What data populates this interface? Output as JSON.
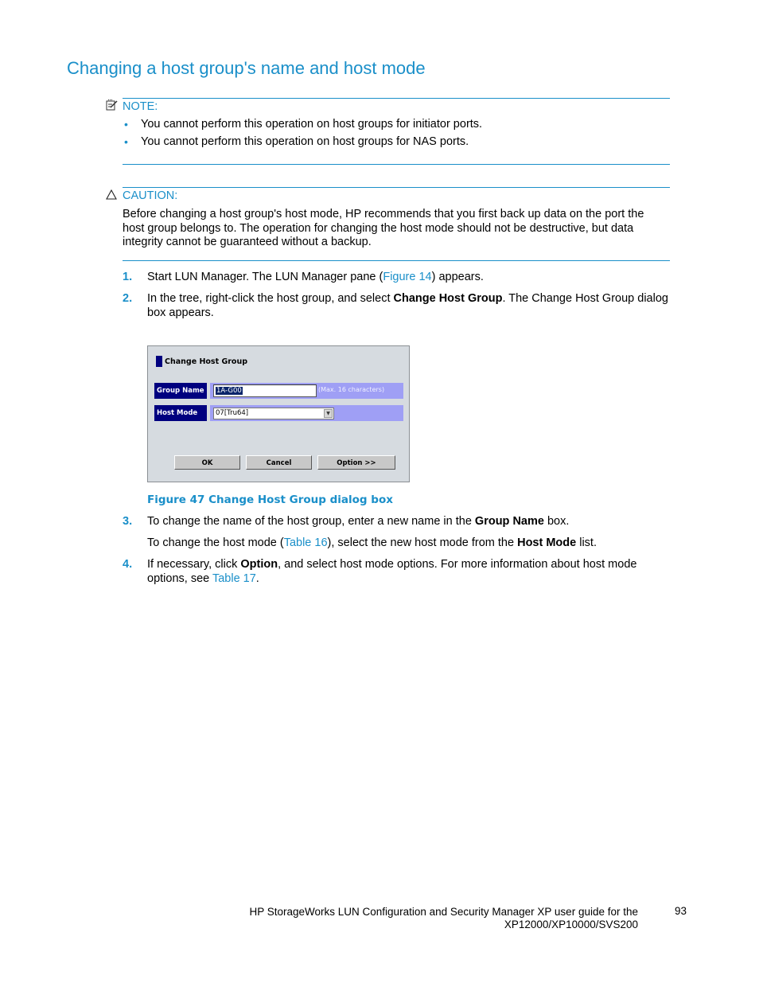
{
  "page": {
    "title": "Changing a host group's name and host mode",
    "note": {
      "label": "NOTE:",
      "icon": "note-pencil-icon",
      "items": [
        "You cannot perform this operation on host groups for initiator ports.",
        "You cannot perform this operation on host groups for NAS ports."
      ]
    },
    "caution": {
      "label": "CAUTION:",
      "icon": "warning-triangle-icon",
      "text": "Before changing a host group's host mode, HP recommends that you first back up data on the port the host group belongs to.  The operation for changing the host mode should not be destructive, but data integrity cannot be guaranteed without a backup."
    },
    "steps": [
      {
        "num": "1.",
        "parts": [
          "Start LUN Manager.  The LUN Manager pane (",
          "Figure 14",
          ") appears."
        ]
      },
      {
        "num": "2.",
        "parts": [
          "In the tree, right-click the host group, and select ",
          "Change Host Group",
          ".  The Change Host Group dialog box appears."
        ]
      },
      {
        "num": "3.",
        "parts": [
          "To change the name of the host group, enter a new name in the ",
          "Group Name",
          " box."
        ],
        "sub": [
          "To change the host mode (",
          "Table 16",
          "), select the new host mode from the ",
          "Host Mode",
          " list."
        ]
      },
      {
        "num": "4.",
        "parts": [
          "If necessary, click ",
          "Option",
          ", and select host mode options.  For more information about host mode options, see ",
          "Table 17",
          "."
        ]
      }
    ],
    "figure": {
      "caption": "Figure 47 Change Host Group dialog box",
      "dialog": {
        "title": "Change Host Group",
        "group_name_label": "Group Name",
        "group_name_value": "1A-G00",
        "group_name_hint": "(Max. 16 characters)",
        "host_mode_label": "Host Mode",
        "host_mode_value": "07[Tru64]",
        "ok_label": "OK",
        "cancel_label": "Cancel",
        "option_label": "Option >>"
      }
    },
    "footer": {
      "line1": "HP StorageWorks LUN Configuration and Security Manager XP user guide for the",
      "line2": "XP12000/XP10000/SVS200",
      "page_number": "93"
    }
  },
  "colors": {
    "accent": "#1a8fc9",
    "dialog_bg": "#d6dbe0",
    "dialog_label_bg": "#00007f",
    "dialog_field_bg": "#9f9ff5"
  }
}
